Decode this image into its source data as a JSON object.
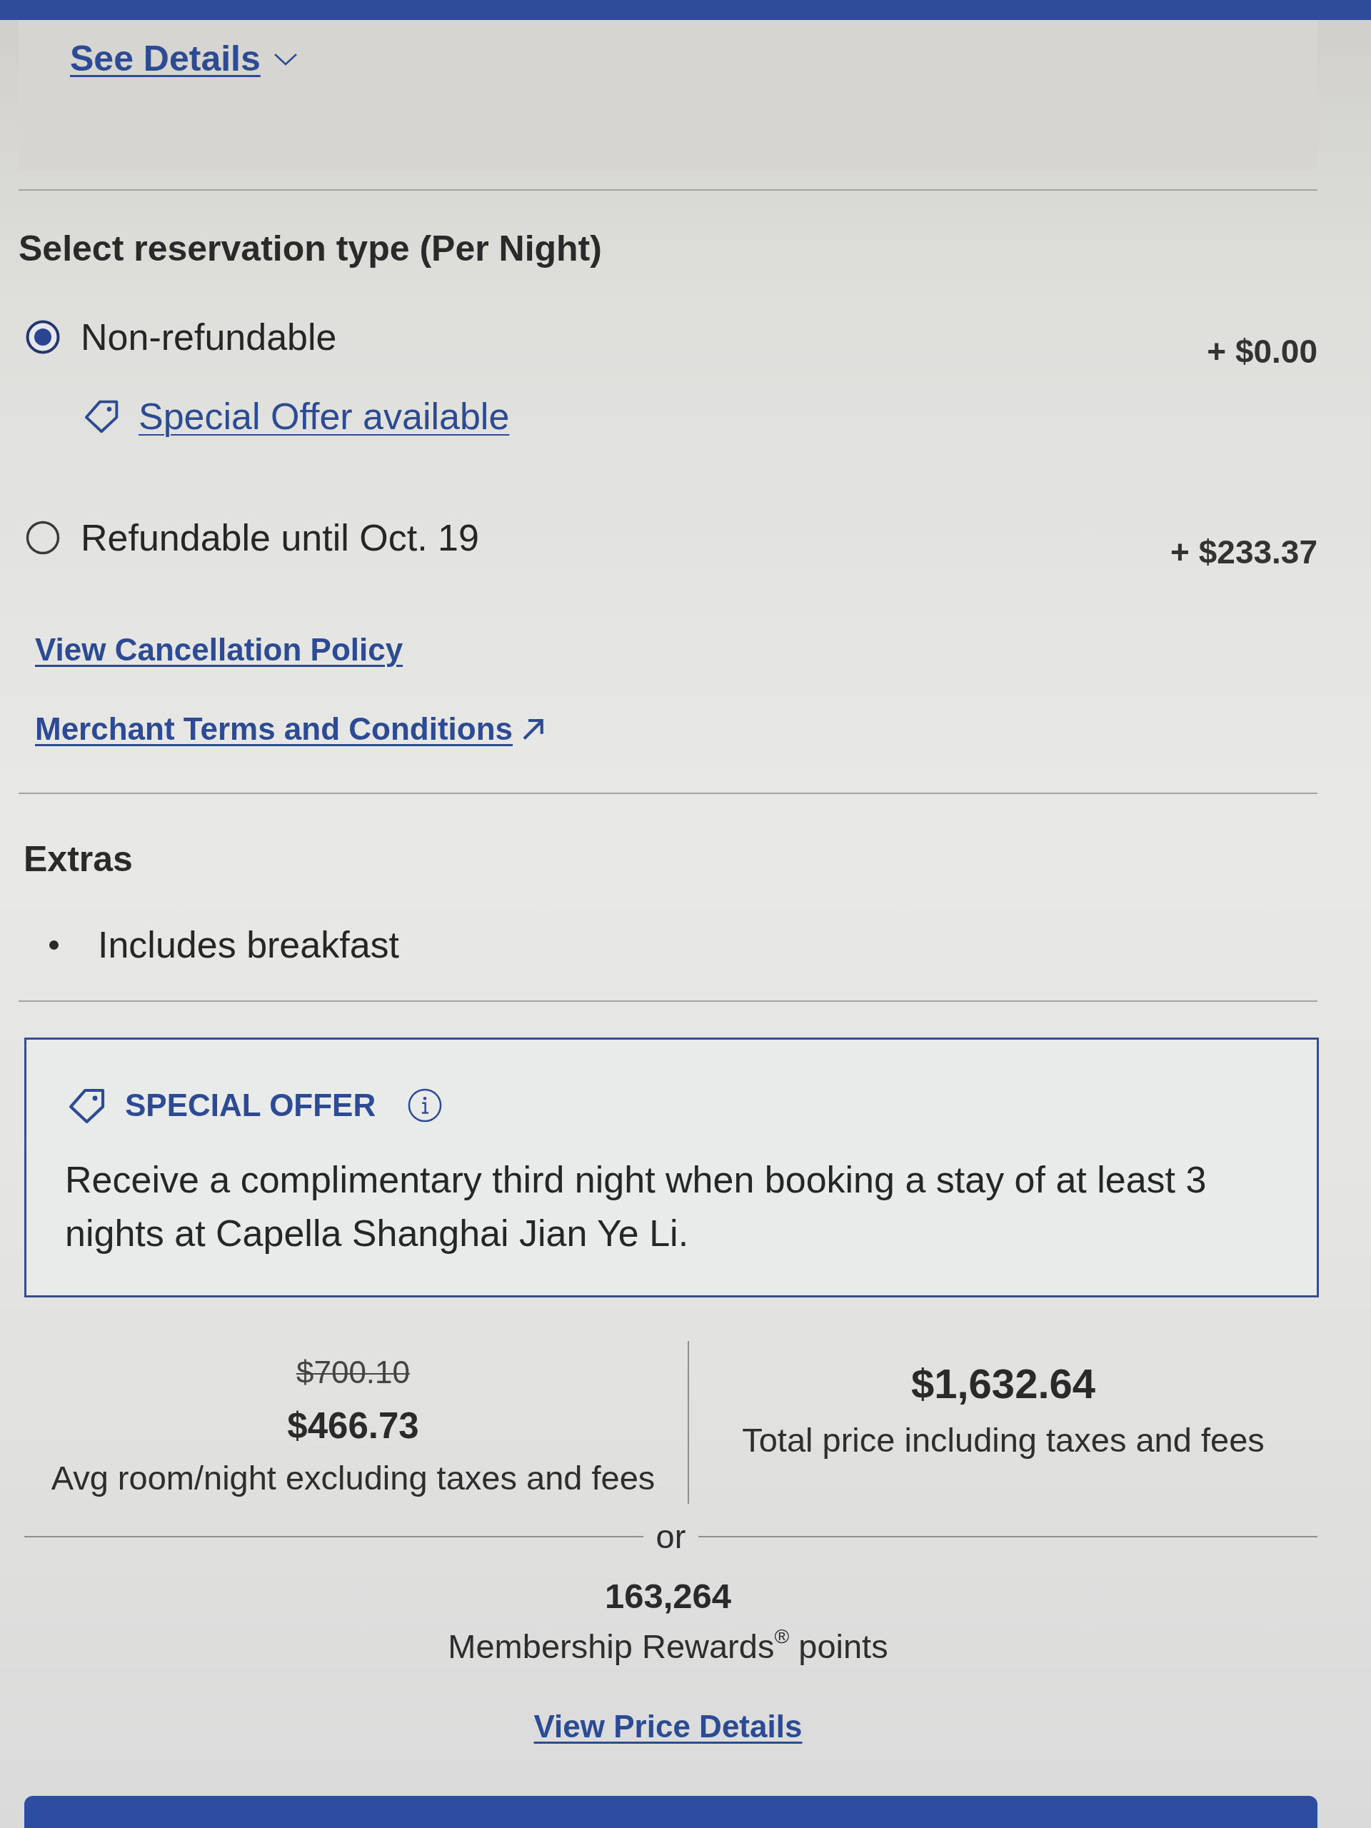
{
  "details_panel": {
    "link": "See Details",
    "expanded": false
  },
  "reservation": {
    "heading": "Select reservation type (Per Night)",
    "options": [
      {
        "label": "Non-refundable",
        "price": "+ $0.00",
        "selected": true,
        "offer_link": "Special Offer available"
      },
      {
        "label": "Refundable until Oct. 19",
        "price": "+ $233.37",
        "selected": false
      }
    ],
    "links": [
      {
        "label": "View Cancellation Policy",
        "external": false
      },
      {
        "label": "Merchant Terms and Conditions",
        "external": true
      }
    ]
  },
  "extras": {
    "heading": "Extras",
    "items": [
      "Includes breakfast"
    ]
  },
  "special_offer": {
    "title": "SPECIAL OFFER",
    "text": "Receive a complimentary third night when booking a stay of at least 3 nights at Capella Shanghai Jian Ye Li."
  },
  "pricing": {
    "original_nightly": "$700.10",
    "nightly": "$466.73",
    "nightly_label": "Avg room/night excluding taxes and fees",
    "total": "$1,632.64",
    "total_label": "Total price including taxes and fees",
    "separator": "or",
    "points": "163,264",
    "points_label": "Membership Rewards$^{®}$ points",
    "details_link": "View Price Details"
  }
}
